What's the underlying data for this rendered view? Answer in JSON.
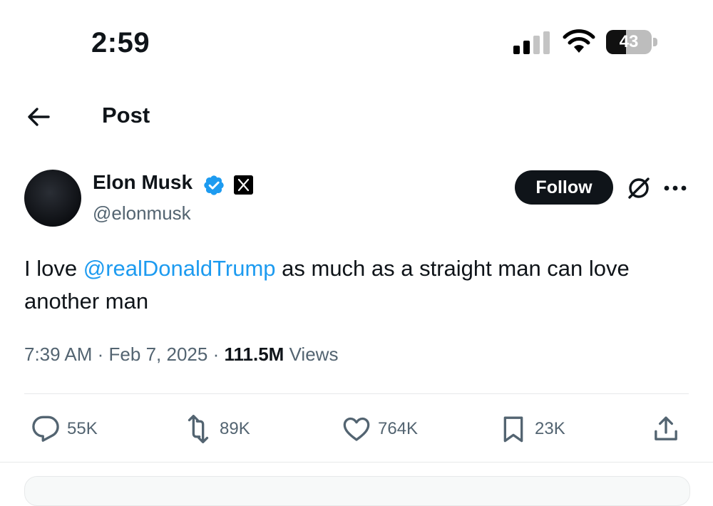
{
  "status_bar": {
    "time": "2:59",
    "battery_percent": "43",
    "battery_level": 0.43,
    "signal_bars_active": 2,
    "signal_bars_total": 4
  },
  "header": {
    "title": "Post",
    "back_icon": "arrow-left-icon"
  },
  "author": {
    "display_name": "Elon Musk",
    "handle": "@elonmusk",
    "verified_color": "#1d9bf0",
    "affiliation_badge": "x-logo-icon"
  },
  "follow_button": {
    "label": "Follow"
  },
  "tweet": {
    "text_before": "I love ",
    "mention": "@realDonaldTrump",
    "text_after": " as much as a straight man can love another man",
    "time": "7:39 AM",
    "separator": "·",
    "date": "Feb 7, 2025",
    "views_count": "111.5M",
    "views_label": "Views"
  },
  "actions": {
    "replies": "55K",
    "reposts": "89K",
    "likes": "764K",
    "bookmarks": "23K"
  },
  "colors": {
    "accent": "#1d9bf0",
    "text_primary": "#0f1419",
    "text_secondary": "#536471",
    "divider": "#e7e9ea"
  }
}
